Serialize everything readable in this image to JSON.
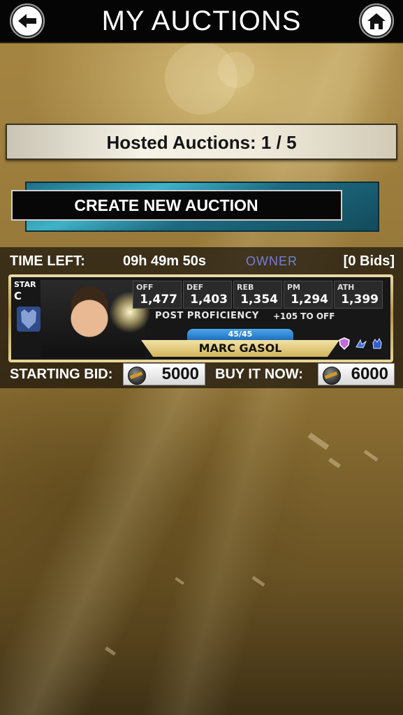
{
  "header": {
    "title": "MY AUCTIONS",
    "back_icon": "back-arrow-icon",
    "home_icon": "home-icon"
  },
  "hosted": {
    "text": "Hosted Auctions: 1 / 5",
    "count": 1,
    "max": 5
  },
  "create": {
    "label": "CREATE NEW AUCTION"
  },
  "auction": {
    "time_label": "TIME LEFT:",
    "time_value": "09h 49m 50s",
    "owner_label": "OWNER",
    "bids": "[0 Bids]",
    "card": {
      "tier": "STAR",
      "position": "C",
      "team_icon": "grizzlies-logo-icon",
      "stats": [
        {
          "label": "OFF",
          "value": "1,477"
        },
        {
          "label": "DEF",
          "value": "1,403"
        },
        {
          "label": "REB",
          "value": "1,354"
        },
        {
          "label": "PM",
          "value": "1,294"
        },
        {
          "label": "ATH",
          "value": "1,399"
        }
      ],
      "proficiency": "POST PROFICIENCY",
      "proficiency_bonus": "+105 TO OFF",
      "level": "45/45",
      "player_name": "MARC GASOL",
      "badges": [
        "shield-badge-icon",
        "wings-badge-icon",
        "glove-badge-icon"
      ]
    },
    "starting_bid_label": "STARTING BID:",
    "starting_bid": "5000",
    "buy_now_label": "BUY IT NOW:",
    "buy_now": "6000"
  },
  "colors": {
    "owner": "#6f7fd9",
    "create_bg": "#2e93ab",
    "gold": "#c9a54f"
  }
}
